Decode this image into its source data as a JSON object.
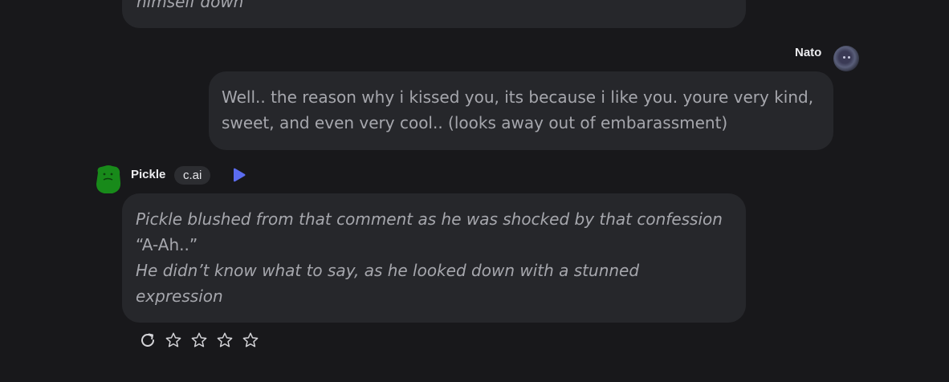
{
  "previous_message": {
    "text": "himself down"
  },
  "user": {
    "name": "Nato",
    "message": [
      "Well.. the reason why i kissed you, its because i like you. youre very kind,",
      "sweet, and even very cool.. (looks away out of embarassment)"
    ]
  },
  "bot": {
    "name": "Pickle",
    "badge": "c.ai",
    "message": [
      {
        "text": "Pickle blushed from that comment as he was shocked by that confession",
        "style": "italic"
      },
      {
        "text": "“A-Ah..”",
        "style": "normal"
      },
      {
        "text": "He didn’t know what to say, as he looked down with a stunned",
        "style": "italic"
      },
      {
        "text": "expression",
        "style": "italic"
      }
    ]
  },
  "message_actions": {
    "icons": [
      "regenerate-icon",
      "star-icon",
      "star-icon",
      "star-icon",
      "star-icon"
    ],
    "rating": 0
  },
  "colors": {
    "background": "#18181b",
    "bubble": "#26272b",
    "bubble_text": "#a6a7ad",
    "play_accent": "#5b6cf0",
    "bot_avatar": "#188a1a"
  }
}
